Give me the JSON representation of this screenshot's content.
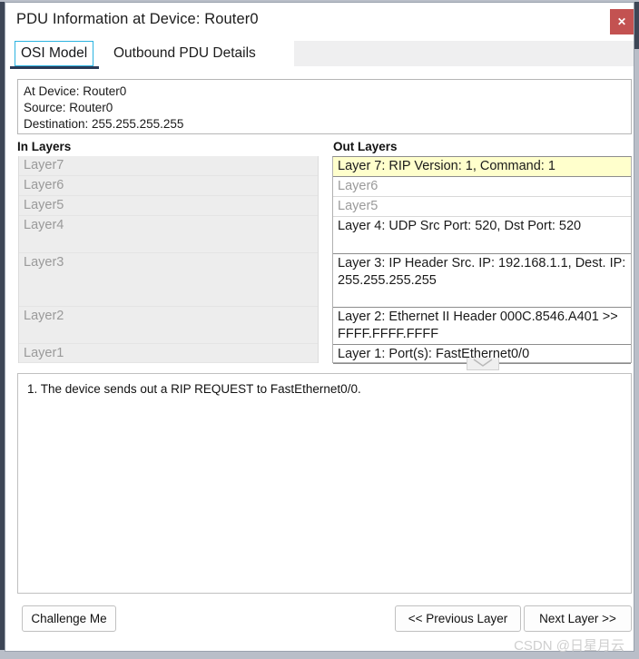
{
  "window": {
    "title": "PDU Information at Device: Router0",
    "close_label": "✕"
  },
  "tabs": [
    {
      "label": "OSI Model",
      "selected": true
    },
    {
      "label": "Outbound PDU Details",
      "selected": false
    }
  ],
  "info": {
    "at_device": "At Device: Router0",
    "source": "Source: Router0",
    "destination": "Destination: 255.255.255.255"
  },
  "columns": {
    "in_heading": "In Layers",
    "out_heading": "Out Layers"
  },
  "in_layers": [
    {
      "label": "Layer7"
    },
    {
      "label": "Layer6"
    },
    {
      "label": "Layer5"
    },
    {
      "label": "Layer4"
    },
    {
      "label": "Layer3"
    },
    {
      "label": "Layer2"
    },
    {
      "label": "Layer1"
    }
  ],
  "out_layers": [
    {
      "label": "Layer 7: RIP Version: 1, Command: 1"
    },
    {
      "label": "Layer6"
    },
    {
      "label": "Layer5"
    },
    {
      "label": "Layer 4: UDP Src Port: 520, Dst Port: 520"
    },
    {
      "label": "Layer 3: IP Header Src. IP: 192.168.1.1, Dest. IP: 255.255.255.255"
    },
    {
      "label": "Layer 2: Ethernet II Header 000C.8546.A401 >> FFFF.FFFF.FFFF"
    },
    {
      "label": "Layer 1: Port(s): FastEthernet0/0"
    }
  ],
  "description": {
    "line1": "1. The device sends out a RIP REQUEST to FastEthernet0/0."
  },
  "footer": {
    "challenge": "Challenge Me",
    "previous": "<< Previous Layer",
    "next": "Next Layer >>"
  },
  "watermark": "CSDN @日星月云",
  "colors": {
    "highlight": "#ffffcc",
    "tab_focus": "#2bb3e0",
    "tab_underline": "#2a3a56",
    "close_button": "#c35251",
    "muted_text": "#9a9a9a",
    "frame": "#3d4656"
  }
}
